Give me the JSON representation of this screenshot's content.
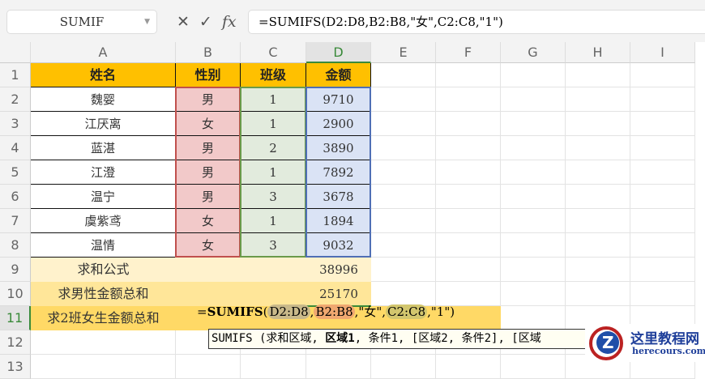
{
  "name_box": "SUMIF",
  "formula_bar": "=SUMIFS(D2:D8,B2:B8,\"女\",C2:C8,\"1\")",
  "columns": [
    "A",
    "B",
    "C",
    "D",
    "E",
    "F",
    "G",
    "H",
    "I"
  ],
  "rows": [
    "1",
    "2",
    "3",
    "4",
    "5",
    "6",
    "7",
    "8",
    "9",
    "10",
    "11",
    "12",
    "13"
  ],
  "headers": [
    "姓名",
    "性别",
    "班级",
    "金额"
  ],
  "data": [
    [
      "魏婴",
      "男",
      "1",
      "9710"
    ],
    [
      "江厌离",
      "女",
      "1",
      "2900"
    ],
    [
      "蓝湛",
      "男",
      "2",
      "3890"
    ],
    [
      "江澄",
      "男",
      "1",
      "7892"
    ],
    [
      "温宁",
      "男",
      "3",
      "3678"
    ],
    [
      "虞紫鸢",
      "女",
      "1",
      "1894"
    ],
    [
      "温情",
      "女",
      "3",
      "9032"
    ]
  ],
  "summary": [
    {
      "label": "求和公式",
      "value": "38996"
    },
    {
      "label": "求男性金额总和",
      "value": "25170"
    },
    {
      "label": "求2班女生金额总和"
    }
  ],
  "editing_formula": {
    "prefix": "=",
    "fn": "SUMIFS",
    "open": "(",
    "arg1": "D2:D8",
    "sep": ",",
    "arg2": "B2:B8",
    "arg3": "\"女\"",
    "arg4": "C2:C8",
    "arg5": "\"1\"",
    "close": ")"
  },
  "tooltip": {
    "start": "SUMIFS (求和区域, ",
    "bold": "区域1",
    "rest": ", 条件1, [区域2, 条件2], [区域"
  },
  "watermark": {
    "name": "这里教程网",
    "url": "herecours.com"
  },
  "colors": {
    "header": "#ffc000",
    "range_b": "#c0504d",
    "range_c": "#6a9a4a",
    "range_d": "#4f6fb5"
  }
}
